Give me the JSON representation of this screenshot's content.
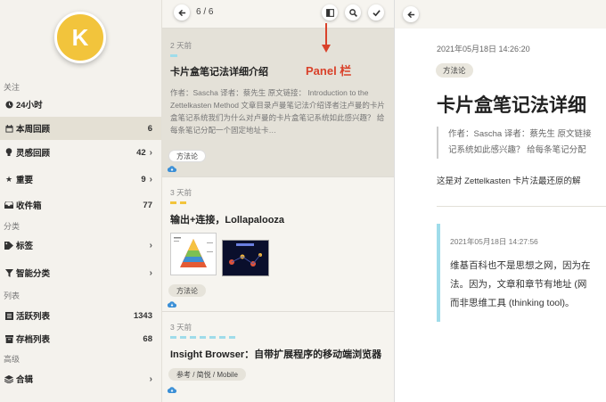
{
  "sidebar": {
    "avatar_letter": "K",
    "sections": {
      "focus": "关注",
      "category": "分类",
      "lists": "列表",
      "advanced": "高级"
    },
    "items": [
      {
        "label": "24小时",
        "icon": "clock-icon",
        "count": "",
        "chevron": false
      },
      {
        "label": "本周回顾",
        "icon": "calendar-icon",
        "count": "6",
        "chevron": false
      },
      {
        "label": "灵感回顾",
        "icon": "bulb-icon",
        "count": "42",
        "chevron": true
      },
      {
        "label": "重要",
        "icon": "star-icon",
        "count": "9",
        "chevron": true
      },
      {
        "label": "收件箱",
        "icon": "inbox-icon",
        "count": "77",
        "chevron": false
      },
      {
        "label": "标签",
        "icon": "tag-icon",
        "count": "",
        "chevron": true
      },
      {
        "label": "智能分类",
        "icon": "funnel-icon",
        "count": "",
        "chevron": true
      },
      {
        "label": "活跃列表",
        "icon": "list-icon",
        "count": "1343",
        "chevron": false
      },
      {
        "label": "存档列表",
        "icon": "archive-icon",
        "count": "68",
        "chevron": false
      },
      {
        "label": "合辑",
        "icon": "layers-icon",
        "count": "",
        "chevron": true
      }
    ],
    "chevron_glyph": "›"
  },
  "panel": {
    "pager": "6 / 6",
    "annotation": "Panel 栏",
    "cards": [
      {
        "when": "2 天前",
        "title": "卡片盒笔记法详细介绍",
        "excerpt": "作者：Sascha 译者：蔡先生 原文链接： Introduction to the Zettelkasten Method 文章目录卢曼笔记法介绍译者注卢曼的卡片盒笔记系统我们为什么对卢曼的卡片盒笔记系统如此感兴趣？ 给每条笔记分配一个固定地址卡…",
        "tag": "方法论"
      },
      {
        "when": "3 天前",
        "title": "输出+连接，Lollapalooza",
        "tag": "方法论"
      },
      {
        "when": "3 天前",
        "title": "Insight Browser：自带扩展程序的移动端浏览器",
        "tag": "参考 / 简悦 / Mobile"
      }
    ]
  },
  "detail": {
    "date": "2021年05月18日 14:26:20",
    "tag": "方法论",
    "title": "卡片盒笔记法详细",
    "quote_line1": "作者：Sascha 译者：蔡先生 原文链接",
    "quote_line2": "记系统如此感兴趣？ 给每条笔记分配",
    "para": "这是对 Zettelkasten 卡片法最还原的解",
    "sub_date": "2021年05月18日 14:27:56",
    "sub_line1": "维基百科也不是思想之网，因为在",
    "sub_line2": "法。因为，文章和章节有地址 (网",
    "sub_line3": "而非思维工具 (thinking tool)。"
  },
  "colors": {
    "accent_yellow": "#f2c43c",
    "annotation_red": "#d9412a",
    "quote_bar_blue": "#9fdcea",
    "cloud_blue": "#3b8fd6"
  }
}
